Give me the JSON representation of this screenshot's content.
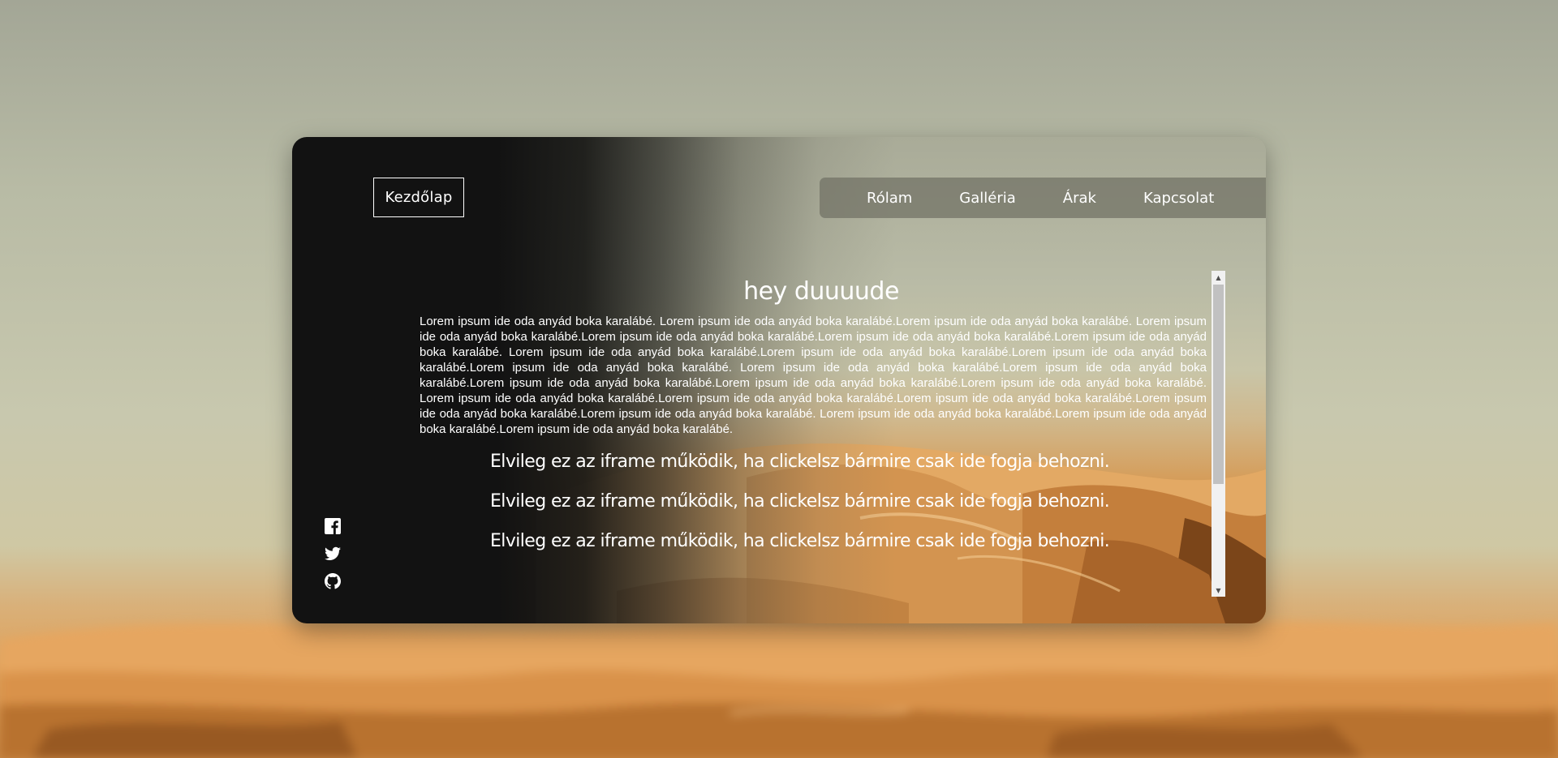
{
  "header": {
    "home_label": "Kezdőlap",
    "nav": [
      {
        "label": "Rólam"
      },
      {
        "label": "Galléria"
      },
      {
        "label": "Árak"
      },
      {
        "label": "Kapcsolat"
      }
    ]
  },
  "main": {
    "heading": "hey duuuude",
    "paragraph": "Lorem ipsum ide oda anyád boka karalábé. Lorem ipsum ide oda anyád boka karalábé.Lorem ipsum ide oda anyád boka karalábé. Lorem ipsum ide oda anyád boka karalábé.Lorem ipsum ide oda anyád boka karalábé.Lorem ipsum ide oda anyád boka karalábé.Lorem ipsum ide oda anyád boka karalábé. Lorem ipsum ide oda anyád boka karalábé.Lorem ipsum ide oda anyád boka karalábé.Lorem ipsum ide oda anyád boka karalábé.Lorem ipsum ide oda anyád boka karalábé. Lorem ipsum ide oda anyád boka karalábé.Lorem ipsum ide oda anyád boka karalábé.Lorem ipsum ide oda anyád boka karalábé.Lorem ipsum ide oda anyád boka karalábé.Lorem ipsum ide oda anyád boka karalábé. Lorem ipsum ide oda anyád boka karalábé.Lorem ipsum ide oda anyád boka karalábé.Lorem ipsum ide oda anyád boka karalábé.Lorem ipsum ide oda anyád boka karalábé.Lorem ipsum ide oda anyád boka karalábé. Lorem ipsum ide oda anyád boka karalábé.Lorem ipsum ide oda anyád boka karalábé.Lorem ipsum ide oda anyád boka karalábé.",
    "iframe_lines": [
      "Elvileg ez az iframe működik, ha clickelsz bármire csak ide fogja behozni.",
      "Elvileg ez az iframe működik, ha clickelsz bármire csak ide fogja behozni.",
      "Elvileg ez az iframe működik, ha clickelsz bármire csak ide fogja behozni."
    ]
  },
  "social": [
    {
      "icon": "facebook-icon"
    },
    {
      "icon": "twitter-icon"
    },
    {
      "icon": "github-icon"
    }
  ],
  "colors": {
    "sidebar_dark": "#121212",
    "nav_bg": "#707064",
    "text": "#ffffff",
    "sand": "#e0a35c"
  }
}
